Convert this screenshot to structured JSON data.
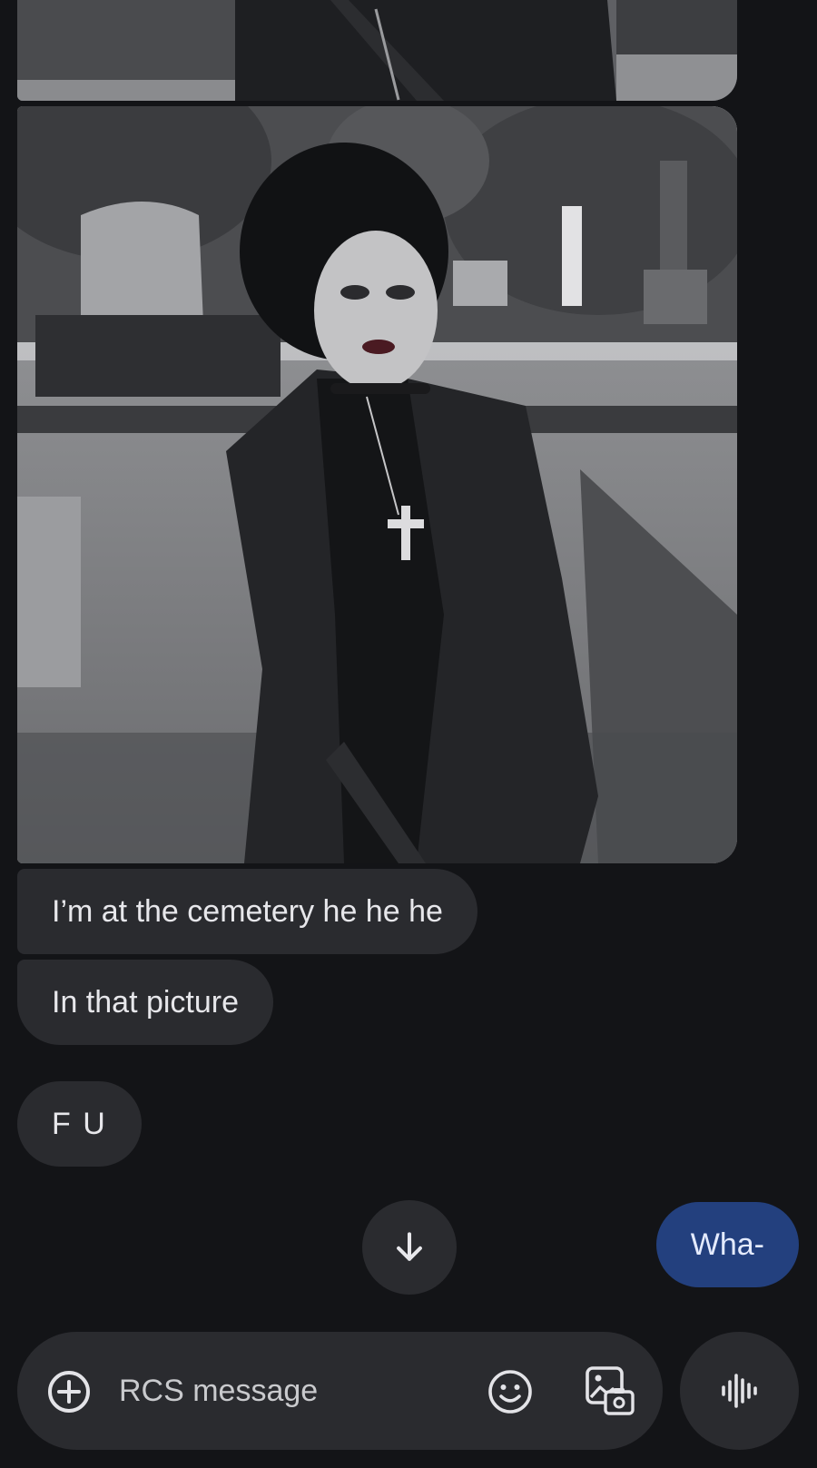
{
  "conversation": {
    "attachments": [
      {
        "kind": "photo",
        "subject": "cemetery photo (continued)"
      },
      {
        "kind": "photo",
        "subject": "cemetery photo"
      }
    ],
    "incoming": [
      {
        "text": "I’m at the cemetery he he he"
      },
      {
        "text": "In that picture"
      },
      {
        "text": "F U"
      }
    ],
    "outgoing": [
      {
        "text": "Wha-"
      }
    ]
  },
  "controls": {
    "scroll_down_icon": "arrow-down-icon",
    "add_icon": "plus-circle-icon",
    "emoji_icon": "emoji-icon",
    "gallery_icon": "gallery-icon",
    "voice_icon": "voice-waveform-icon"
  },
  "composer": {
    "placeholder": "RCS message",
    "value": ""
  },
  "colors": {
    "background": "#131417",
    "incoming_bubble": "#2a2b2f",
    "outgoing_bubble": "#23407e"
  }
}
